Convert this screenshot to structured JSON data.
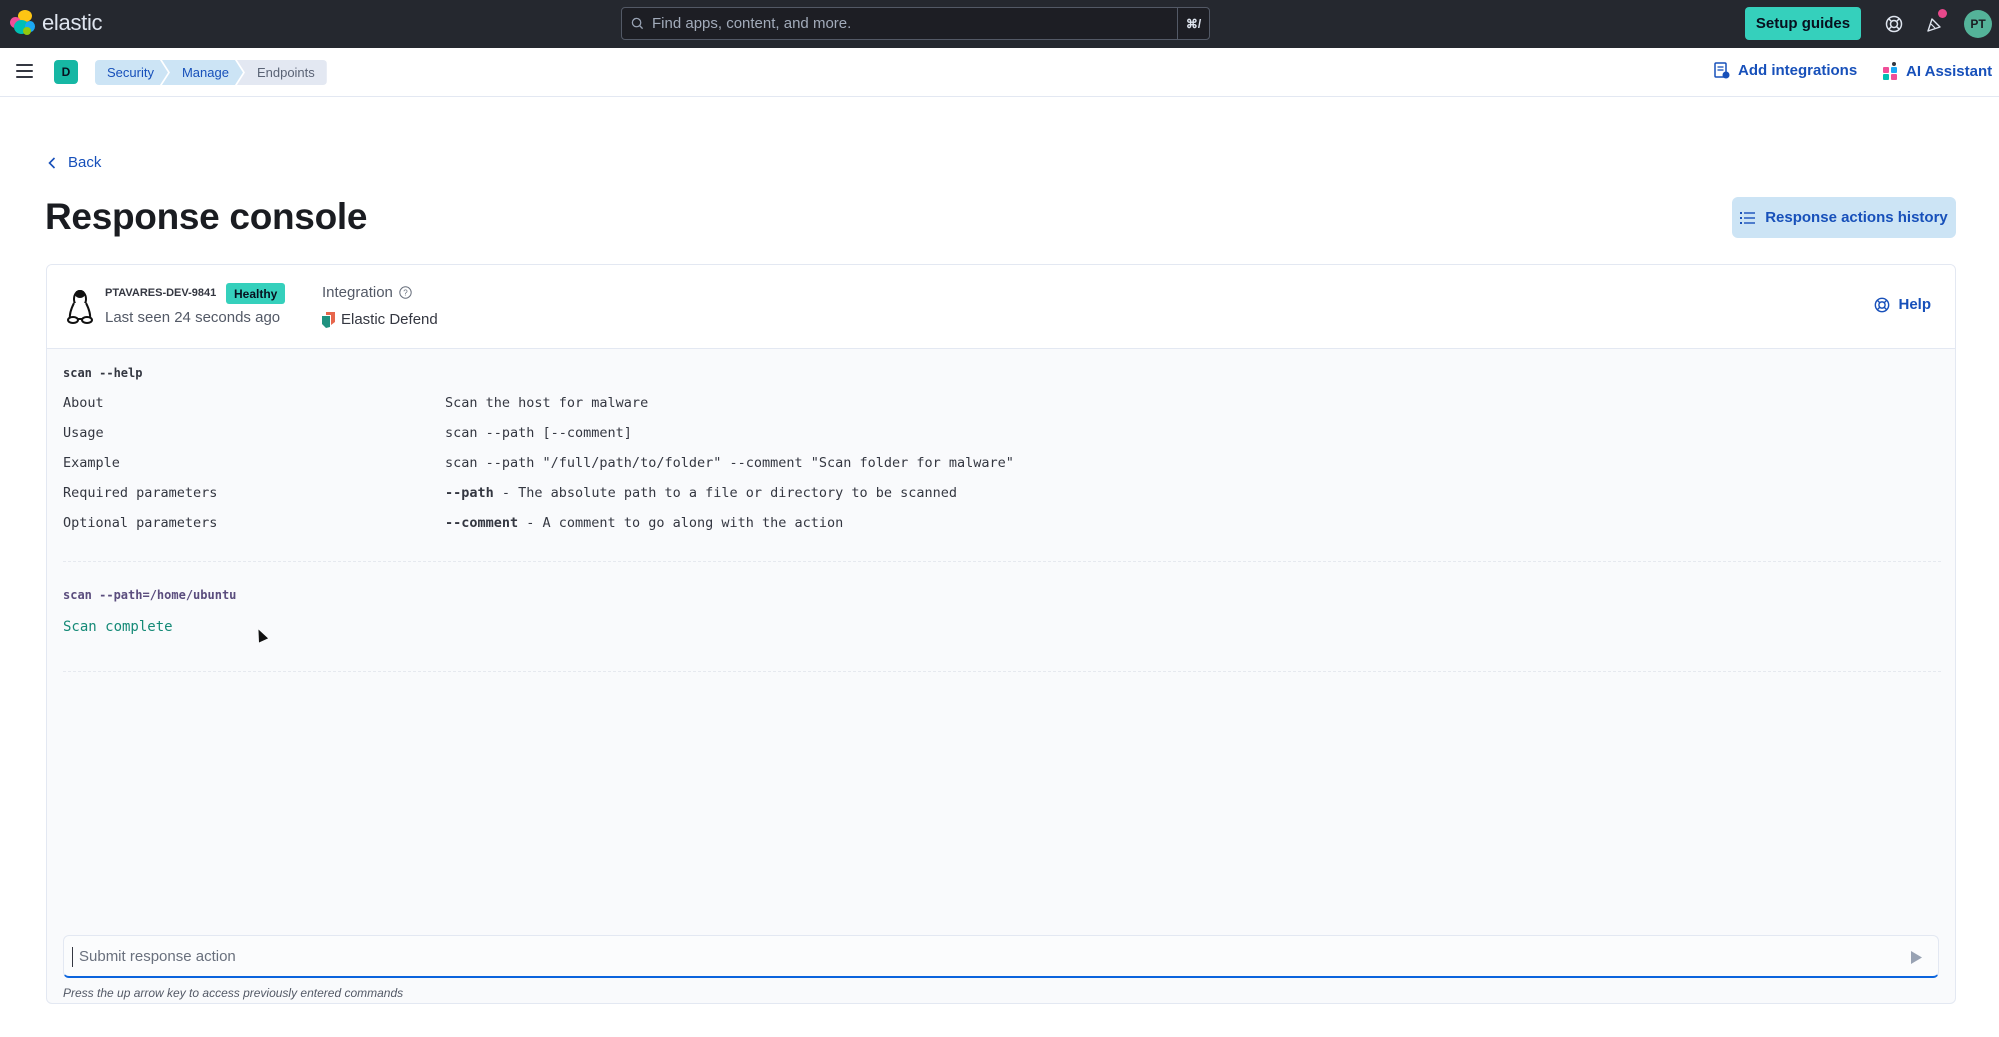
{
  "header": {
    "logo_text": "elastic",
    "search_placeholder": "Find apps, content, and more.",
    "search_shortcut": "⌘/",
    "setup_guides_label": "Setup guides",
    "help_icon": "lifebuoy-icon",
    "news_icon": "cheer-icon",
    "user_initials": "PT",
    "notification_color": "#e8488b"
  },
  "subheader": {
    "space_initial": "D",
    "breadcrumbs": [
      {
        "label": "Security"
      },
      {
        "label": "Manage"
      },
      {
        "label": "Endpoints"
      }
    ],
    "add_integrations_label": "Add integrations",
    "ai_assistant_label": "AI Assistant"
  },
  "page": {
    "back_label": "Back",
    "title": "Response console",
    "history_button_label": "Response actions history"
  },
  "endpoint": {
    "hostname": "PTAVARES-DEV-9841",
    "status": "Healthy",
    "last_seen": "Last seen 24 seconds ago",
    "integration_label": "Integration",
    "integration_value": "Elastic Defend",
    "help_label": "Help",
    "os_icon": "linux-icon"
  },
  "console": {
    "help_command": "scan --help",
    "help_rows": [
      {
        "key": "About",
        "value": "Scan the host for malware"
      },
      {
        "key": "Usage",
        "value": "scan --path [--comment]"
      },
      {
        "key": "Example",
        "value": "scan --path \"/full/path/to/folder\" --comment \"Scan folder for malware\""
      },
      {
        "key": "Required parameters",
        "value_bold": "--path",
        "value": " - The absolute path to a file or directory to be scanned"
      },
      {
        "key": "Optional parameters",
        "value_bold": "--comment",
        "value": " - A comment to go along with the action"
      }
    ],
    "scan_command": "scan --path=/home/ubuntu",
    "scan_result": "Scan complete",
    "input_placeholder": "Submit response action",
    "input_value": "",
    "hint": "Press the up arrow key to access previously entered commands"
  },
  "colors": {
    "accent": "#1750ba",
    "success": "#35d0bc",
    "result_text": "#158a77",
    "header_bg": "#25282f"
  }
}
